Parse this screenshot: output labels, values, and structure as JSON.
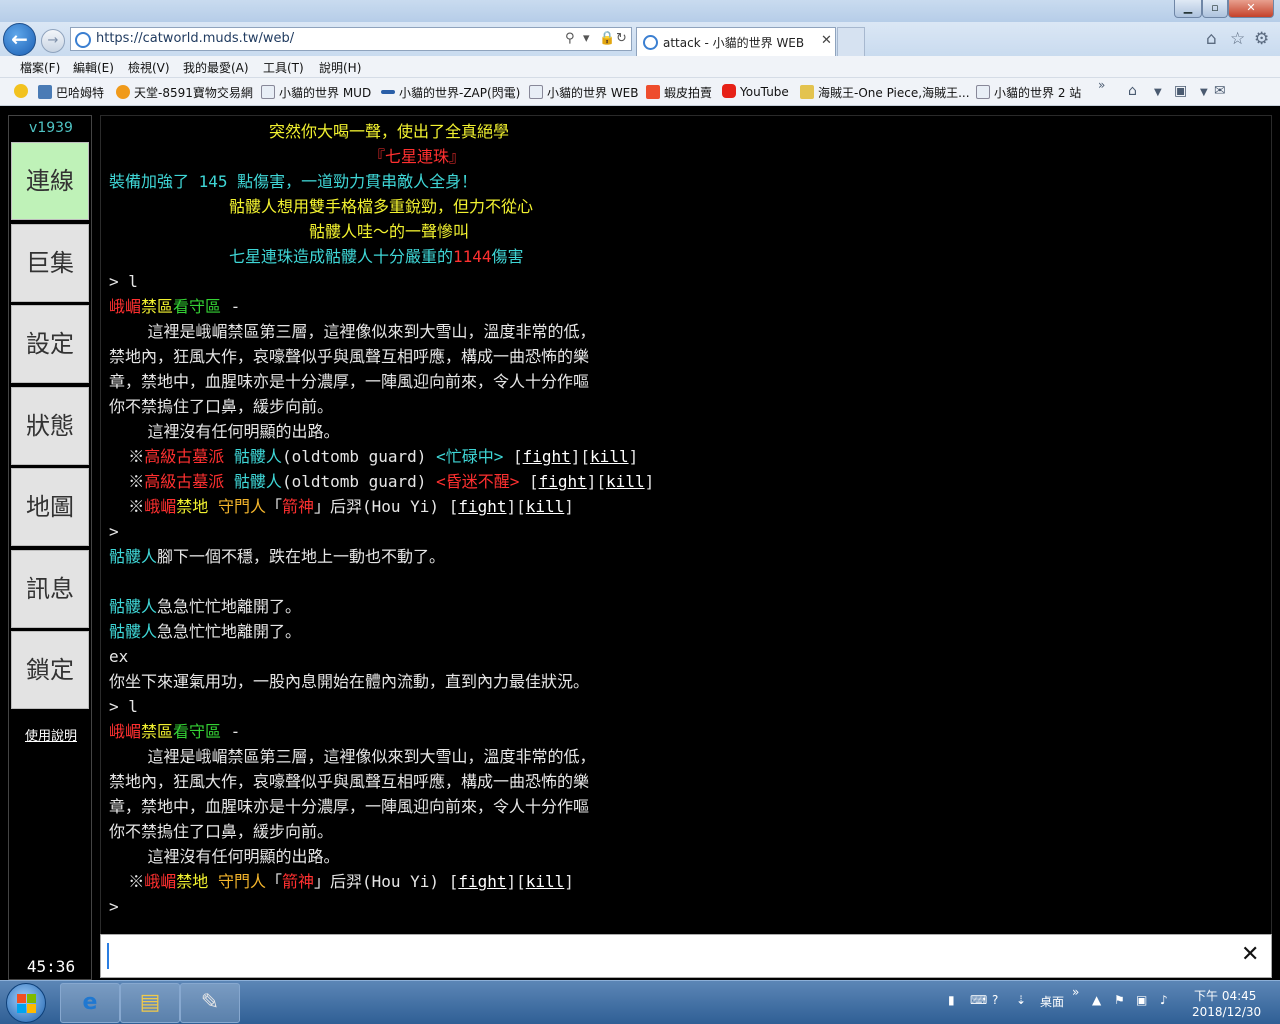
{
  "browser": {
    "url": "https://catworld.muds.tw/web/",
    "tab_title": "attack - 小貓的世界 WEB",
    "menu": [
      "檔案(F)",
      "編輯(E)",
      "檢視(V)",
      "我的最愛(A)",
      "工具(T)",
      "說明(H)"
    ],
    "favorites": [
      "巴哈姆特",
      "天堂-8591寶物交易網",
      "小貓的世界 MUD",
      "小貓的世界-ZAP(閃電)",
      "小貓的世界 WEB",
      "蝦皮拍賣",
      "YouTube",
      "海賊王-One Piece,海賊王...",
      "小貓的世界 2 站"
    ]
  },
  "sidebar": {
    "version": "v1939",
    "buttons": [
      "連線",
      "巨集",
      "設定",
      "狀態",
      "地圖",
      "訊息",
      "鎖定"
    ],
    "help": "使用說明",
    "timer": "45:36"
  },
  "terminal": {
    "l1": "突然你大喝一聲，使出了全真絕學",
    "l2": "『七星連珠』",
    "l3": "裝備加強了 145 點傷害，一道勁力貫串敵人全身！",
    "l4": "骷髏人想用雙手格檔多重銳勁，但力不從心",
    "l5": "骷髏人哇～的一聲慘叫",
    "l6a": "七星連珠造成骷髏人十分嚴重的",
    "l6b": "1144",
    "l6c": "傷害",
    "prompt_l": "> l",
    "room_a": "峨嵋",
    "room_b": "禁區",
    "room_c": "看守區",
    "room_d": " -",
    "desc1": "    這裡是峨嵋禁區第三層，這裡像似來到大雪山，溫度非常的低，",
    "desc2": "禁地內，狂風大作，哀嚎聲似乎與風聲互相呼應，構成一曲恐怖的樂",
    "desc3": "章，禁地中，血腥味亦是十分濃厚，一陣風迎向前來，令人十分作嘔",
    "desc4": "你不禁摀住了口鼻，緩步向前。",
    "exits": "    這裡沒有任何明顯的出路。",
    "mark": "  ※",
    "m1_faction": "高級古墓派",
    "m1_name": " 骷髏人",
    "m1_eng": "(oldtomb guard) ",
    "m1_state": "<忙碌中>",
    "m2_state": "<昏迷不醒>",
    "fight": "fight",
    "kill": "kill",
    "hy_a": "峨嵋",
    "hy_b": "禁地",
    "hy_c": " 守門人",
    "hy_d": "「",
    "hy_e": "箭神",
    "hy_f": "」后羿(Hou Yi) ",
    "prompt": ">",
    "fall_a": "骷髏人",
    "fall_b": "腳下一個不穩，跌在地上一動也不動了。",
    "leave_a": "骷髏人",
    "leave_b": "急急忙忙地離開了。",
    "ex": "ex",
    "ex_msg": "你坐下來運氣用功，一股內息開始在體內流動，直到內力最佳狀況。"
  },
  "input": {
    "clear": "✕"
  },
  "taskbar": {
    "desktop": "桌面",
    "time": "下午 04:45",
    "date": "2018/12/30"
  }
}
